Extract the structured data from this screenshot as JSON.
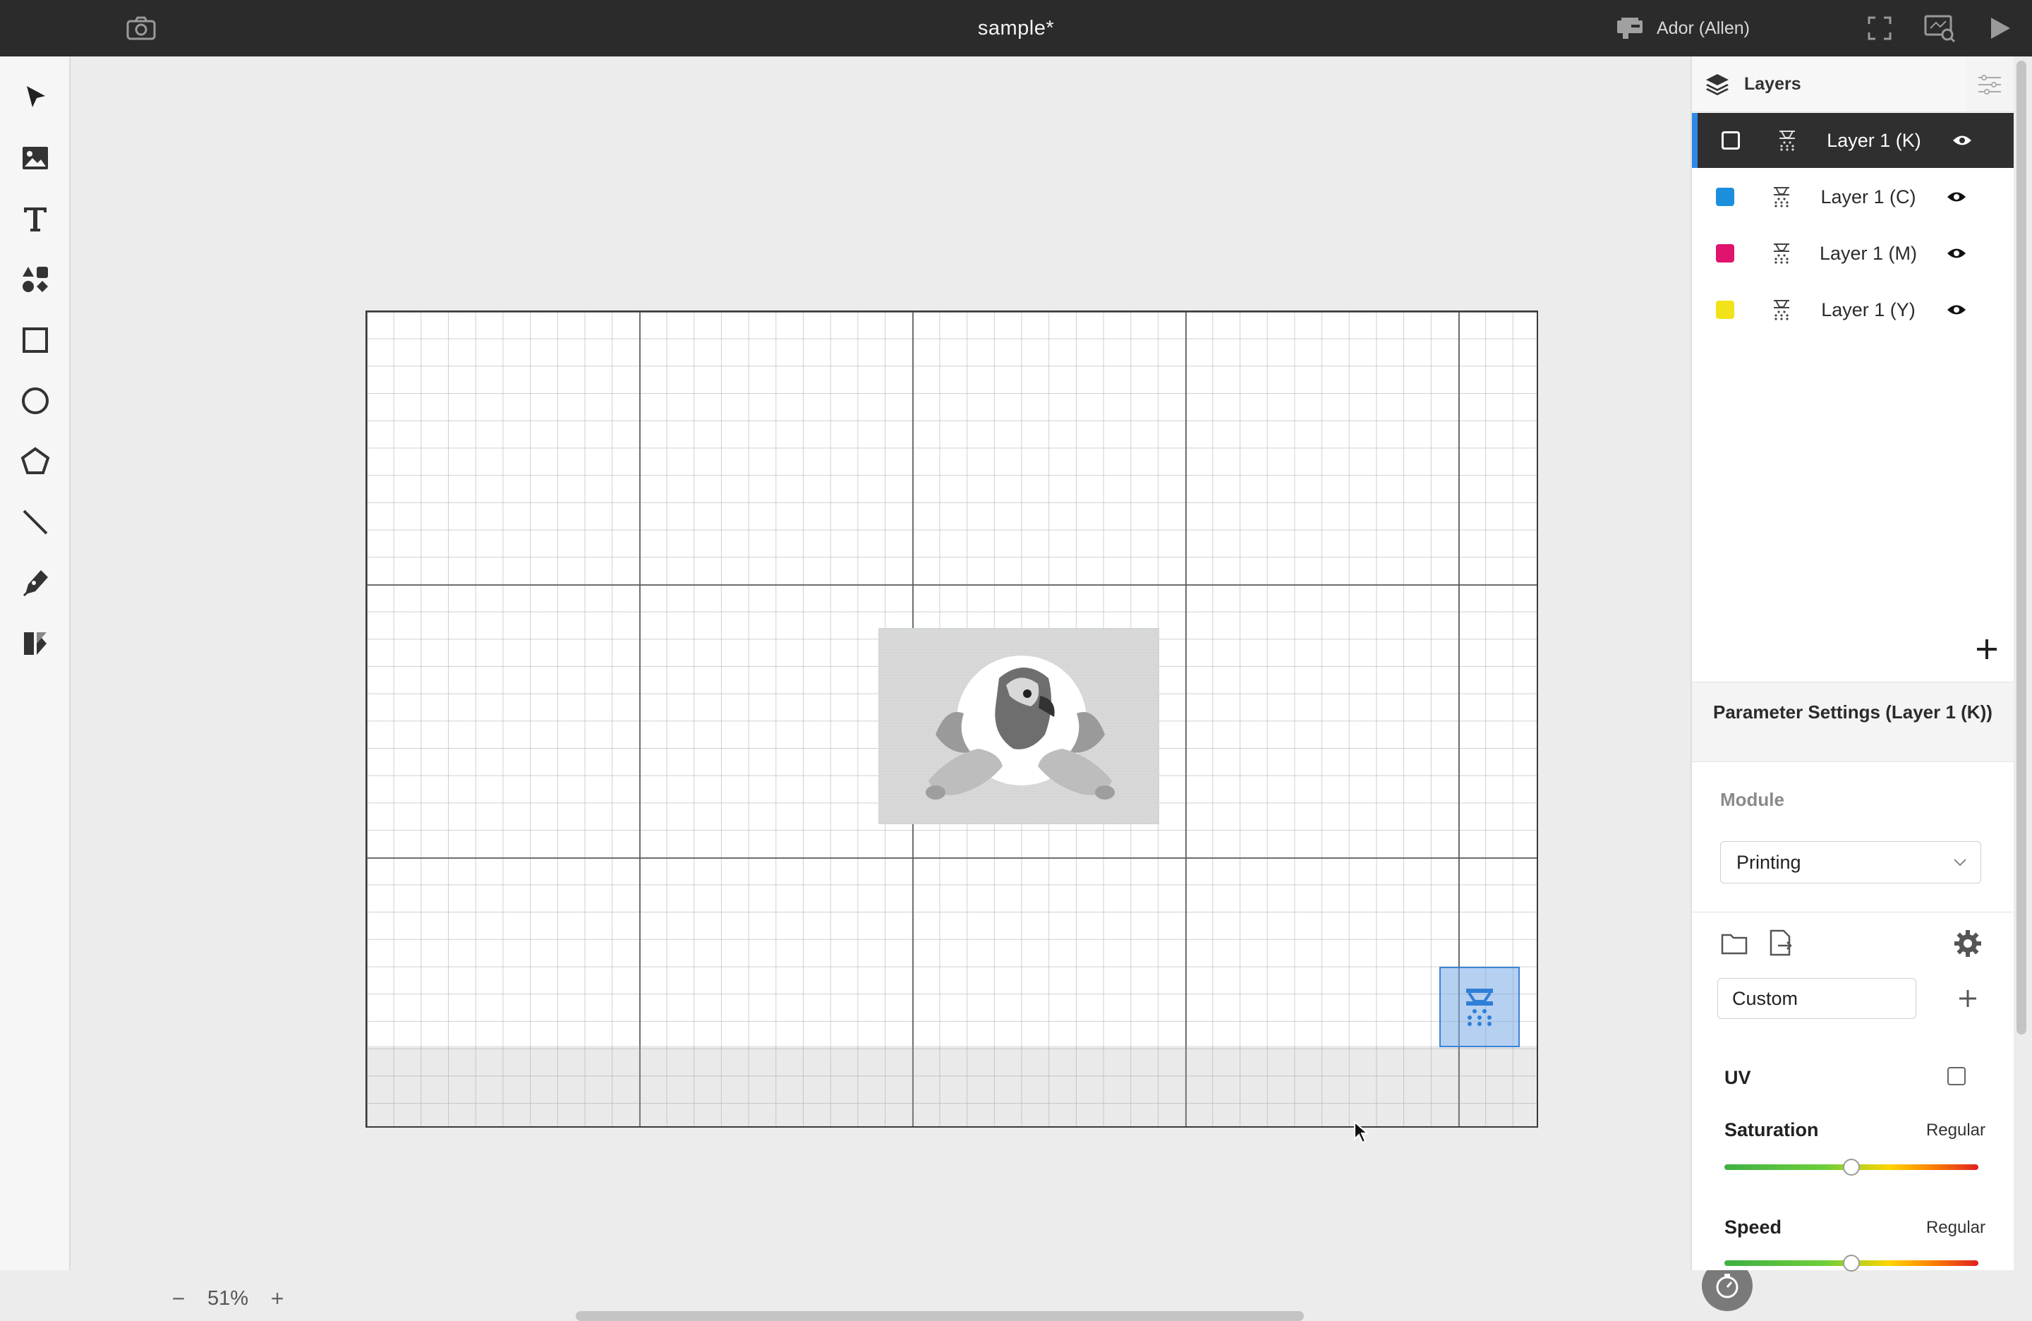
{
  "window": {
    "title": "sample*"
  },
  "topbar": {
    "camera_icon": "camera-icon",
    "machine_label": "Ador (Allen)",
    "machine_icon": "machine-icon",
    "fullscreen_icon": "fullscreen-icon",
    "preview_icon": "preview-icon",
    "play_icon": "play-icon"
  },
  "tools": [
    {
      "name": "select-tool",
      "icon": "cursor-icon"
    },
    {
      "name": "image-tool",
      "icon": "image-icon"
    },
    {
      "name": "text-tool",
      "icon": "text-icon"
    },
    {
      "name": "elements-tool",
      "icon": "shapes-icon"
    },
    {
      "name": "rectangle-tool",
      "icon": "rectangle-icon"
    },
    {
      "name": "ellipse-tool",
      "icon": "ellipse-icon"
    },
    {
      "name": "polygon-tool",
      "icon": "polygon-icon"
    },
    {
      "name": "line-tool",
      "icon": "line-icon"
    },
    {
      "name": "pen-tool",
      "icon": "pen-icon"
    },
    {
      "name": "dmkt-tool",
      "icon": "dmkt-icon"
    }
  ],
  "canvas": {
    "zoom": "51%",
    "zoom_out": "−",
    "zoom_in": "+"
  },
  "layers_panel": {
    "tab_label": "Layers",
    "layers": [
      {
        "name": "Layer 1 (K)",
        "color": "#ffffff",
        "selected": true
      },
      {
        "name": "Layer 1 (C)",
        "color": "#1c8fdc",
        "selected": false
      },
      {
        "name": "Layer 1 (M)",
        "color": "#e0136e",
        "selected": false
      },
      {
        "name": "Layer 1 (Y)",
        "color": "#f2e21a",
        "selected": false
      }
    ]
  },
  "params": {
    "title": "Parameter Settings (Layer 1 (K))",
    "module_label": "Module",
    "module_value": "Printing",
    "preset_value": "Custom",
    "uv_label": "UV",
    "uv_checked": false,
    "saturation_label": "Saturation",
    "saturation_value": "Regular",
    "speed_label": "Speed",
    "speed_value": "Regular"
  },
  "colors": {
    "accent": "#2f88e8",
    "topbar": "#2b2b2b",
    "selected_row": "#2f2f2f"
  }
}
